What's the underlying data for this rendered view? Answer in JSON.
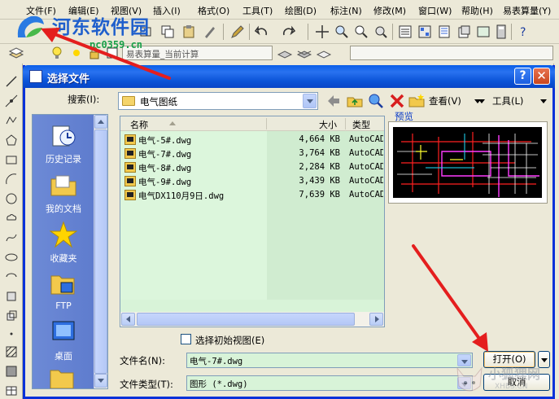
{
  "app": {
    "menu": [
      "文件(F)",
      "编辑(E)",
      "视图(V)",
      "插入(I)",
      "格式(O)",
      "工具(T)",
      "绘图(D)",
      "标注(N)",
      "修改(M)",
      "窗口(W)",
      "帮助(H)",
      "易表算量(Y)"
    ],
    "layer_combo": "易表算量_当前计算"
  },
  "watermark": {
    "title": "河东软件园",
    "url": "pc0359.cn"
  },
  "dialog": {
    "title": "选择文件",
    "help_symbol": "?",
    "close_symbol": "✕",
    "look_in_label": "搜索(I):",
    "look_in_value": "电气图纸",
    "view_label": "查看(V)",
    "tools_label": "工具(L)",
    "preview_label": "预览",
    "places": [
      {
        "label": "历史记录",
        "icon": "history-icon"
      },
      {
        "label": "我的文档",
        "icon": "my-documents-icon"
      },
      {
        "label": "收藏夹",
        "icon": "favorites-icon"
      },
      {
        "label": "FTP",
        "icon": "ftp-icon"
      },
      {
        "label": "桌面",
        "icon": "desktop-icon"
      }
    ],
    "columns": {
      "name": "名称",
      "size": "大小",
      "type": "类型"
    },
    "files": [
      {
        "name": "电气-5#.dwg",
        "size": "4,664 KB",
        "type": "AutoCAD"
      },
      {
        "name": "电气-7#.dwg",
        "size": "3,764 KB",
        "type": "AutoCAD"
      },
      {
        "name": "电气-8#.dwg",
        "size": "2,284 KB",
        "type": "AutoCAD"
      },
      {
        "name": "电气-9#.dwg",
        "size": "3,439 KB",
        "type": "AutoCAD"
      },
      {
        "name": "电气DX110月9日.dwg",
        "size": "7,639 KB",
        "type": "AutoCAD"
      }
    ],
    "initial_view_label": "选择初始视图(E)",
    "initial_view_checked": false,
    "filename_label": "文件名(N):",
    "filename_value": "电气-7#.dwg",
    "filetype_label": "文件类型(T):",
    "filetype_value": "图形 (*.dwg)",
    "open_label": "打开(O)",
    "cancel_label": "取消"
  },
  "corner_watermark": {
    "text": "小狐狸网",
    "url": "XHBS.CN"
  },
  "colors": {
    "titlebar": "#0a5fe8",
    "list_bg": "#d8f3d8",
    "annotation_arrow": "#e41e1e"
  }
}
